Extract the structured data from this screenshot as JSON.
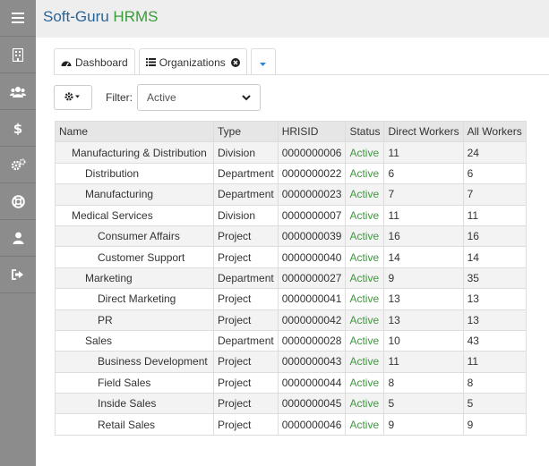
{
  "brand": {
    "part1": "Soft-Guru ",
    "part2": "HRMS"
  },
  "sidebar": {
    "icons": [
      "menu-icon",
      "building-icon",
      "users-icon",
      "dollar-icon",
      "gears-icon",
      "lifebuoy-icon",
      "user-icon",
      "sign-out-icon"
    ]
  },
  "tabs": [
    {
      "label": "Dashboard",
      "icon": "dashboard-icon"
    },
    {
      "label": "Organizations",
      "icon": "list-icon",
      "closable": true
    }
  ],
  "toolbar": {
    "filter_label": "Filter:",
    "filter_value": "Active"
  },
  "table": {
    "headers": [
      "Name",
      "Type",
      "HRISID",
      "Status",
      "Direct Workers",
      "All Workers"
    ],
    "rows": [
      {
        "name": "Manufacturing & Distribution",
        "level": 0,
        "type": "Division",
        "hrisid": "0000000006",
        "status": "Active",
        "direct": "11",
        "all": "24"
      },
      {
        "name": "Distribution",
        "level": 1,
        "type": "Department",
        "hrisid": "0000000022",
        "status": "Active",
        "direct": "6",
        "all": "6"
      },
      {
        "name": "Manufacturing",
        "level": 1,
        "type": "Department",
        "hrisid": "0000000023",
        "status": "Active",
        "direct": "7",
        "all": "7"
      },
      {
        "name": "Medical Services",
        "level": 0,
        "type": "Division",
        "hrisid": "0000000007",
        "status": "Active",
        "direct": "11",
        "all": "11"
      },
      {
        "name": "Consumer Affairs",
        "level": 2,
        "type": "Project",
        "hrisid": "0000000039",
        "status": "Active",
        "direct": "16",
        "all": "16"
      },
      {
        "name": "Customer Support",
        "level": 2,
        "type": "Project",
        "hrisid": "0000000040",
        "status": "Active",
        "direct": "14",
        "all": "14"
      },
      {
        "name": "Marketing",
        "level": 1,
        "type": "Department",
        "hrisid": "0000000027",
        "status": "Active",
        "direct": "9",
        "all": "35"
      },
      {
        "name": "Direct Marketing",
        "level": 2,
        "type": "Project",
        "hrisid": "0000000041",
        "status": "Active",
        "direct": "13",
        "all": "13"
      },
      {
        "name": "PR",
        "level": 2,
        "type": "Project",
        "hrisid": "0000000042",
        "status": "Active",
        "direct": "13",
        "all": "13"
      },
      {
        "name": "Sales",
        "level": 1,
        "type": "Department",
        "hrisid": "0000000028",
        "status": "Active",
        "direct": "10",
        "all": "43"
      },
      {
        "name": "Business Development",
        "level": 2,
        "type": "Project",
        "hrisid": "0000000043",
        "status": "Active",
        "direct": "11",
        "all": "11"
      },
      {
        "name": "Field Sales",
        "level": 2,
        "type": "Project",
        "hrisid": "0000000044",
        "status": "Active",
        "direct": "8",
        "all": "8"
      },
      {
        "name": "Inside Sales",
        "level": 2,
        "type": "Project",
        "hrisid": "0000000045",
        "status": "Active",
        "direct": "5",
        "all": "5"
      },
      {
        "name": "Retail Sales",
        "level": 2,
        "type": "Project",
        "hrisid": "0000000046",
        "status": "Active",
        "direct": "9",
        "all": "9"
      }
    ]
  },
  "colors": {
    "sidebar": "#8c8c8c",
    "brand_blue": "#2a6496",
    "brand_green": "#3a9b3a",
    "status_active": "#3a9b3a"
  }
}
